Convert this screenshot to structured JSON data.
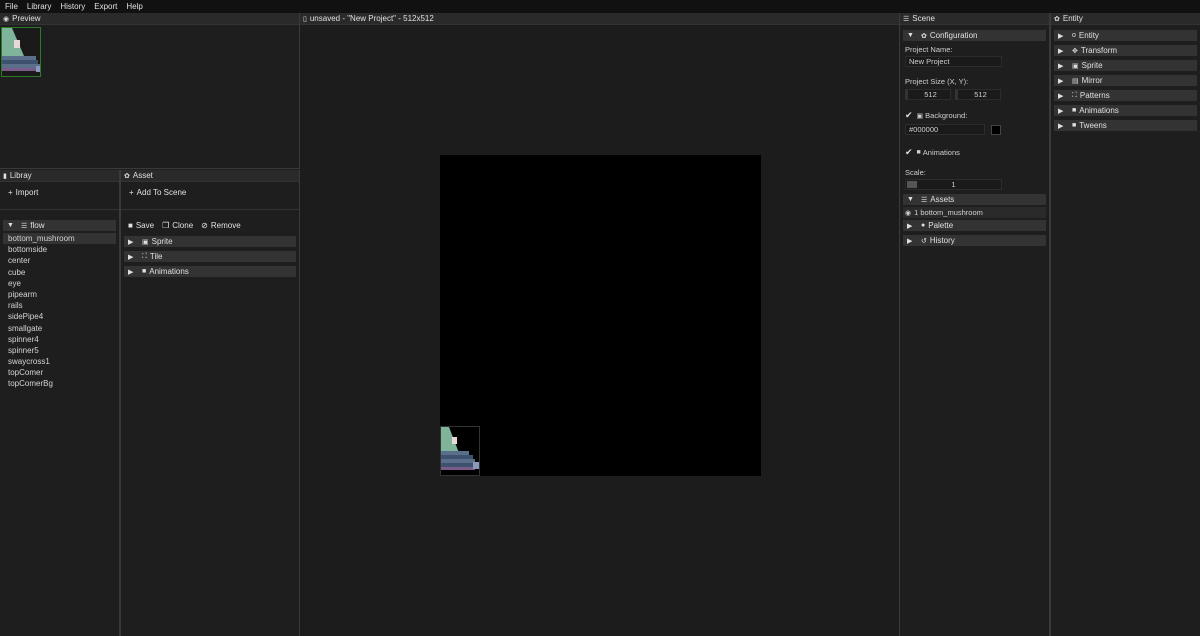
{
  "menu": [
    "File",
    "Library",
    "History",
    "Export",
    "Help"
  ],
  "preview": {
    "title": "Preview"
  },
  "library": {
    "title": "Libray",
    "import_label": "Import",
    "folder_label": "flow",
    "items": [
      "bottom_mushroom",
      "bottomside",
      "center",
      "cube",
      "eye",
      "pipearm",
      "rails",
      "sidePipe4",
      "smallgate",
      "spinner4",
      "spinner5",
      "swaycross1",
      "topComer",
      "topComerBg"
    ]
  },
  "asset": {
    "title": "Asset",
    "add_label": "Add To Scene",
    "save_label": "Save",
    "clone_label": "Clone",
    "remove_label": "Remove",
    "sections": [
      "Sprite",
      "Tile",
      "Animations"
    ]
  },
  "canvas": {
    "title": "unsaved - \"New Project\" - 512x512"
  },
  "scene": {
    "title": "Scene",
    "configuration_label": "Configuration",
    "project_name_label": "Project Name:",
    "project_name_value": "New Project",
    "project_size_label": "Project Size (X, Y):",
    "size_x": "512",
    "size_y": "512",
    "background_label": "Background:",
    "background_value": "#000000",
    "background_color": "#000000",
    "animations_label": "Animations",
    "scale_label": "Scale:",
    "scale_value": "1",
    "assets_label": "Assets",
    "asset_entry": "1 bottom_mushroom",
    "palette_label": "Palette",
    "history_label": "History"
  },
  "entity": {
    "title": "Entity",
    "sections": [
      "Entity",
      "Transform",
      "Sprite",
      "Mirror",
      "Patterns",
      "Animations",
      "Tweens"
    ],
    "icons": [
      "circle-icon",
      "move-icon",
      "image-icon",
      "mirror-icon",
      "expand-icon",
      "video-icon",
      "video-icon"
    ]
  }
}
